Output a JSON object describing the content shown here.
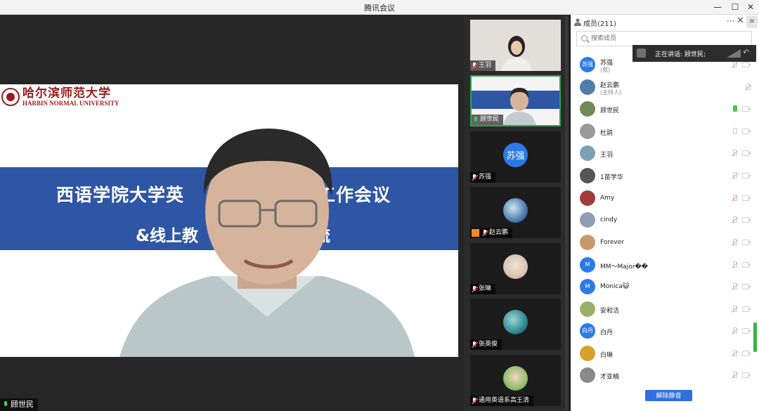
{
  "window": {
    "title": "腾讯会议",
    "controls": {
      "minimize": "—",
      "maximize": "☐",
      "close": "✕"
    }
  },
  "main_video": {
    "speaker_name": "顾世民",
    "slide": {
      "logo_cn": "哈尔滨师范大学",
      "logo_en": "HARBIN NORMAL UNIVERSITY",
      "line1_left": "西语学院大学英",
      "line1_right": "工作会议",
      "line2_left": "&线上教",
      "line2_right": "流"
    }
  },
  "thumbnails": [
    {
      "name": "王羽",
      "kind": "video",
      "muted": true
    },
    {
      "name": "顾世民",
      "kind": "video",
      "muted": false,
      "active": true,
      "mini_slide_text": "西语学院大学英     工作会议",
      "mini_slide_text2": "&线上教"
    },
    {
      "name": "苏强",
      "kind": "avatar",
      "avatar_text": "苏强",
      "avatar_color": "#2c7be5",
      "muted": true
    },
    {
      "name": "赵云鹏",
      "kind": "avatar",
      "avatar_color": "#3a6fa3",
      "muted": true,
      "has_user_badge": true
    },
    {
      "name": "张琳",
      "kind": "avatar",
      "avatar_color": "#d8c6b5",
      "muted": true
    },
    {
      "name": "张英俊",
      "kind": "avatar",
      "avatar_color": "#2f8a8f",
      "muted": true
    },
    {
      "name": "通用英语系高王清",
      "kind": "avatar",
      "avatar_color": "#8fb86b",
      "muted": true
    }
  ],
  "panel": {
    "title": "成员(211)",
    "more": "···",
    "close": "✕",
    "menu": "≡",
    "search_placeholder": "搜索成员",
    "unmute_all": "解除静音",
    "speaking_label": "正在讲话: 顾世民;"
  },
  "members": [
    {
      "name": "苏强",
      "sub": "(我)",
      "avatar_text": "苏强",
      "avatar_color": "#2c7be5",
      "mic": "off",
      "cam": true
    },
    {
      "name": "赵云鹏",
      "sub": "(主持人)",
      "avatar_text": "",
      "avatar_color": "#4f7fa8",
      "mic": "off",
      "cam": false
    },
    {
      "name": "顾世民",
      "sub": "",
      "avatar_text": "",
      "avatar_color": "#6d8b52",
      "mic": "on",
      "cam": true
    },
    {
      "name": "杜鹃",
      "sub": "",
      "avatar_text": "",
      "avatar_color": "#9a9a9a",
      "mic": "idle",
      "cam": true
    },
    {
      "name": "王羽",
      "sub": "",
      "avatar_text": "",
      "avatar_color": "#7ea0b2",
      "mic": "off",
      "cam": true
    },
    {
      "name": "1苗学华",
      "sub": "",
      "avatar_text": "",
      "avatar_color": "#555555",
      "mic": "off",
      "cam": true
    },
    {
      "name": "Amy",
      "sub": "",
      "avatar_text": "",
      "avatar_color": "#a33a3a",
      "mic": "off",
      "cam": true
    },
    {
      "name": "cindy",
      "sub": "",
      "avatar_text": "",
      "avatar_color": "#8f9fb3",
      "mic": "off",
      "cam": true
    },
    {
      "name": "Forever",
      "sub": "",
      "avatar_text": "",
      "avatar_color": "#c79a6e",
      "mic": "off",
      "cam": true
    },
    {
      "name": "MM～Major��",
      "sub": "",
      "avatar_text": "M",
      "avatar_color": "#2c7be5",
      "mic": "off",
      "cam": true
    },
    {
      "name": "Monica😺",
      "sub": "",
      "avatar_text": "M",
      "avatar_color": "#2c7be5",
      "mic": "off",
      "cam": true
    },
    {
      "name": "安和洁",
      "sub": "",
      "avatar_text": "",
      "avatar_color": "#9bb06b",
      "mic": "off",
      "cam": true
    },
    {
      "name": "白丹",
      "sub": "",
      "avatar_text": "白丹",
      "avatar_color": "#2c7be5",
      "mic": "off",
      "cam": true
    },
    {
      "name": "白琳",
      "sub": "",
      "avatar_text": "",
      "avatar_color": "#d9a02b",
      "mic": "off",
      "cam": true
    },
    {
      "name": "才亚楠",
      "sub": "",
      "avatar_text": "",
      "avatar_color": "#888888",
      "mic": "off",
      "cam": true
    }
  ],
  "colors": {
    "accent_blue": "#2f6fe0",
    "speaking_green": "#2ea44f",
    "slide_band": "#2f56a4",
    "logo_red": "#9a1b1e"
  }
}
